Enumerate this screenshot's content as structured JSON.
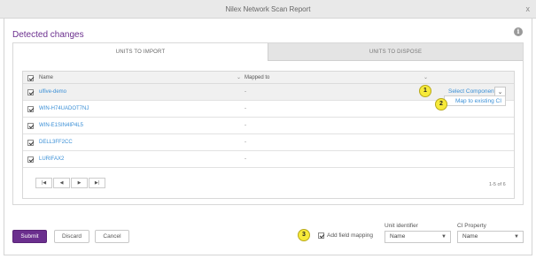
{
  "window": {
    "title": "Nilex Network Scan Report",
    "close": "x"
  },
  "heading": "Detected changes",
  "info_icon": "i",
  "tabs": [
    {
      "label": "UNITS TO IMPORT",
      "active": true
    },
    {
      "label": "UNITS TO DISPOSE",
      "active": false
    }
  ],
  "grid": {
    "columns": {
      "name": "Name",
      "mapped": "Mapped to"
    },
    "rows": [
      {
        "name": "ulfive-demo",
        "mapped": "-",
        "checked": true
      },
      {
        "name": "WIN-H74UADOT7NJ",
        "mapped": "-",
        "checked": true
      },
      {
        "name": "WIN-E1SIN4IP4L5",
        "mapped": "-",
        "checked": true
      },
      {
        "name": "DELL3FF2CC",
        "mapped": "-",
        "checked": true
      },
      {
        "name": "LURIFAX2",
        "mapped": "-",
        "checked": true
      }
    ],
    "select_components": "Select Components",
    "dropdown_caret": "⌄",
    "map_existing": "Map to existing CI",
    "pager": {
      "first": "|◀",
      "prev": "◀",
      "next": "▶",
      "last": "▶|"
    },
    "page_count": "1-5 of 6"
  },
  "callouts": [
    "1",
    "2",
    "3"
  ],
  "buttons": {
    "submit": "Submit",
    "discard": "Discard",
    "cancel": "Cancel"
  },
  "field_mapping": {
    "checkbox_label": "Add field mapping",
    "unit_identifier": {
      "label": "Unit identifier",
      "value": "Name"
    },
    "ci_property": {
      "label": "CI Property",
      "value": "Name"
    }
  },
  "colors": {
    "accent": "#6b2f8e",
    "link": "#3a8fd6",
    "callout": "#f7ea3a"
  }
}
